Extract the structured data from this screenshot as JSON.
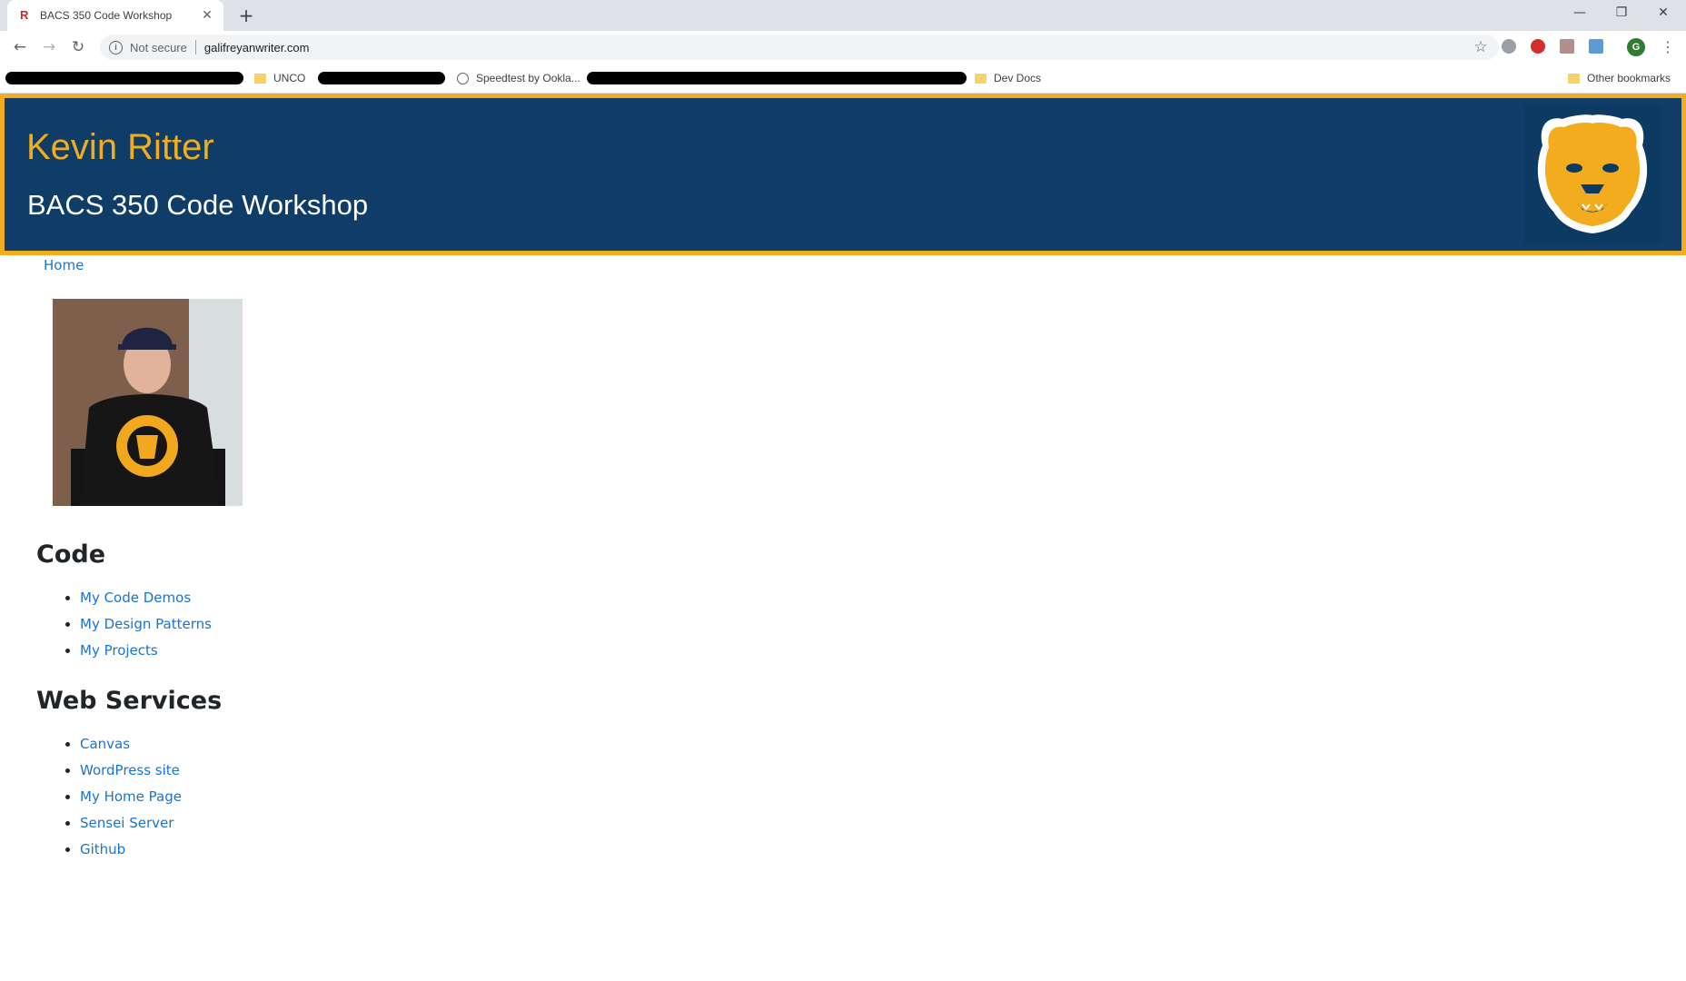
{
  "browser": {
    "tab_title": "BACS 350 Code Workshop",
    "tab_favicon": "R",
    "close_glyph": "✕",
    "new_tab_glyph": "+",
    "window_controls": {
      "minimize": "—",
      "restore": "❐",
      "close": "✕"
    },
    "security_label": "Not secure",
    "url": "galifreyanwriter.com",
    "profile_initial": "G",
    "icons": [
      "back-icon",
      "forward-icon",
      "reload-icon",
      "info-icon",
      "star-icon",
      "extension-icon",
      "pinterest-icon",
      "pdf-icon",
      "image-extension-icon",
      "profile-icon",
      "menu-icon"
    ]
  },
  "bookmarks": [
    {
      "label": "UNCO",
      "icon": "folder-icon"
    },
    {
      "label": "Speedtest by Ookla...",
      "icon": "speedtest-icon"
    },
    {
      "label": "Dev Docs",
      "icon": "folder-icon"
    }
  ],
  "other_bookmarks": "Other bookmarks",
  "header": {
    "name": "Kevin Ritter",
    "subtitle": "BACS 350 Code Workshop"
  },
  "nav": {
    "home": "Home"
  },
  "sections": {
    "code": {
      "title": "Code",
      "links": [
        "My Code Demos",
        "My Design Patterns",
        "My Projects"
      ]
    },
    "web_services": {
      "title": "Web Services",
      "links": [
        "Canvas",
        "WordPress site",
        "My Home Page",
        "Sensei Server",
        "Github"
      ]
    }
  },
  "colors": {
    "header_bg": "#0f3d67",
    "accent_gold": "#f2ac1e",
    "link": "#1a73d0"
  }
}
